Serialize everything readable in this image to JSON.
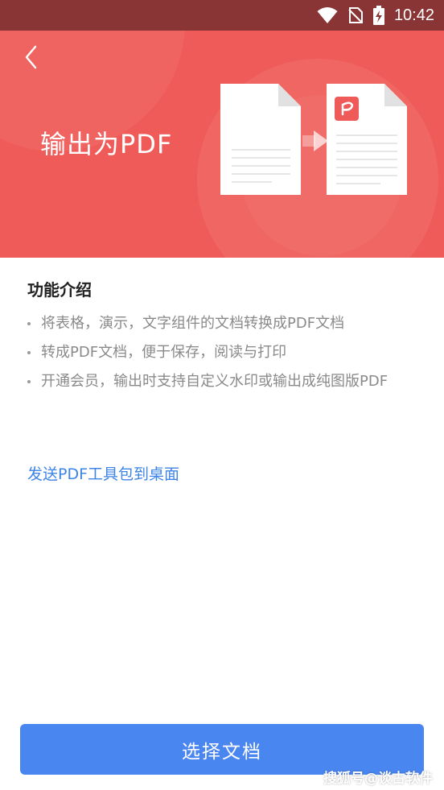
{
  "status_bar": {
    "time": "10:42",
    "icons": [
      "wifi-icon",
      "no-sim-icon",
      "battery-charging-icon"
    ]
  },
  "header": {
    "back_icon": "chevron-left-icon",
    "title": "输出为PDF",
    "illustration": [
      "document-icon",
      "arrow-right-icon",
      "pdf-document-icon"
    ]
  },
  "features": {
    "title": "功能介绍",
    "items": [
      "将表格，演示，文字组件的文档转换成PDF文档",
      "转成PDF文档，便于保存，阅读与打印",
      "开通会员，输出时支持自定义水印或输出成纯图版PDF"
    ]
  },
  "send_shortcut_link": "发送PDF工具包到桌面",
  "primary_button": "选择文档",
  "watermark": "搜狐号@谈古软件",
  "colors": {
    "status_bar": "#8a3535",
    "header_background": "#ef5b58",
    "link": "#3d84e6",
    "button": "#4a86f0",
    "pdf_badge": "#ef5b58"
  }
}
